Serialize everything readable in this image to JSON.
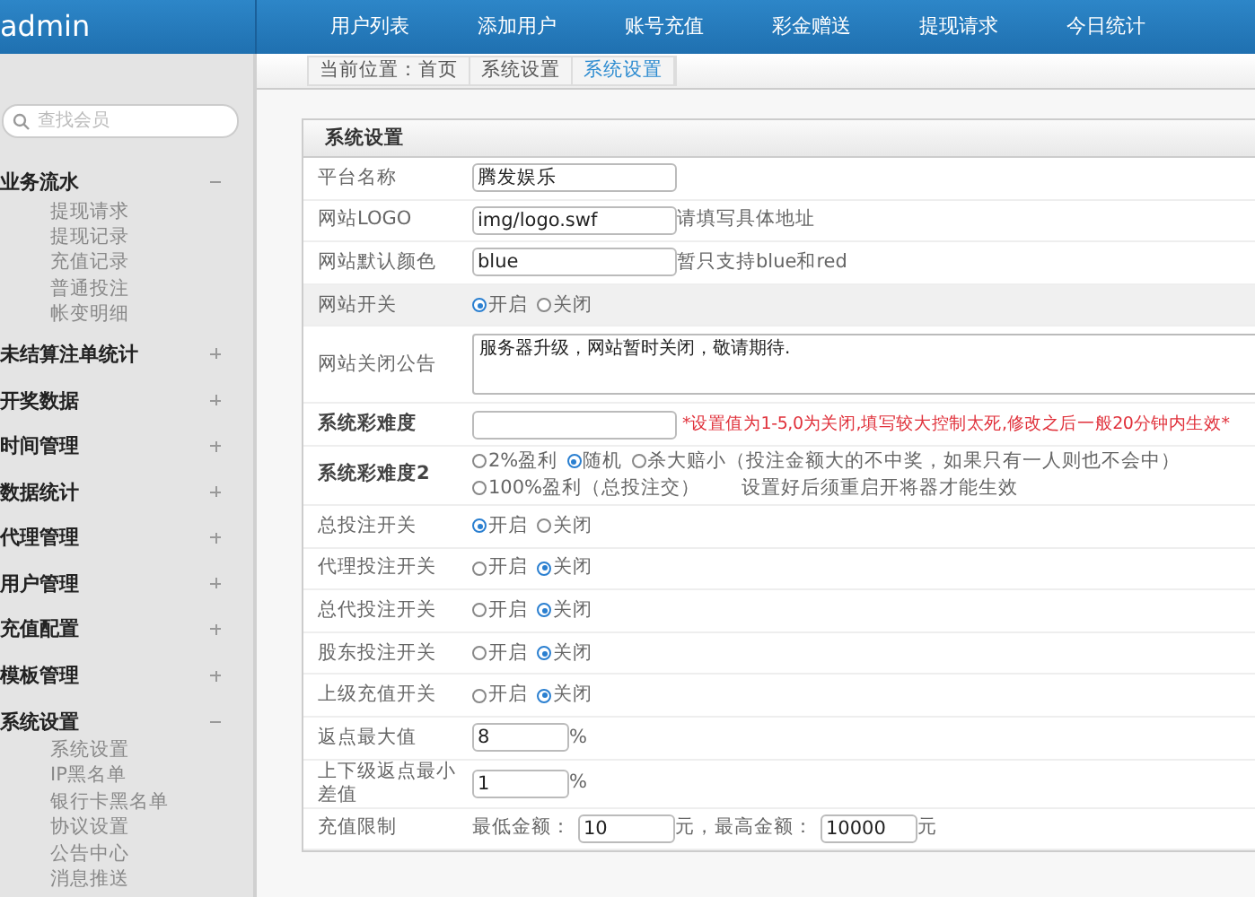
{
  "header": {
    "brand": "admin",
    "nav": [
      "用户列表",
      "添加用户",
      "账号充值",
      "彩金赠送",
      "提现请求",
      "今日统计"
    ]
  },
  "breadcrumb": [
    {
      "text": "当前位置：首页",
      "selected": false
    },
    {
      "text": "系统设置",
      "selected": false
    },
    {
      "text": "系统设置",
      "selected": true
    }
  ],
  "sidebar": {
    "search": {
      "placeholder": "查找会员"
    },
    "groups": [
      {
        "label": "业务流水",
        "expanded": true,
        "children": [
          "提现请求",
          "提现记录",
          "充值记录",
          "普通投注",
          "帐变明细"
        ]
      },
      {
        "label": "未结算注单统计",
        "expanded": false
      },
      {
        "label": "开奖数据",
        "expanded": false
      },
      {
        "label": "时间管理",
        "expanded": false
      },
      {
        "label": "数据统计",
        "expanded": false
      },
      {
        "label": "代理管理",
        "expanded": false
      },
      {
        "label": "用户管理",
        "expanded": false
      },
      {
        "label": "充值配置",
        "expanded": false
      },
      {
        "label": "模板管理",
        "expanded": false
      },
      {
        "label": "系统设置",
        "expanded": true,
        "children": [
          "系统设置",
          "IP黑名单",
          "银行卡黑名单",
          "协议设置",
          "公告中心",
          "消息推送"
        ]
      }
    ]
  },
  "panel": {
    "title": "系统设置",
    "rows": [
      {
        "label": "平台名称",
        "bold": false,
        "highlighted": false,
        "controls": [
          {
            "kind": "input",
            "value": "腾发娱乐"
          }
        ]
      },
      {
        "label": "网站LOGO",
        "bold": false,
        "highlighted": false,
        "controls": [
          {
            "kind": "input",
            "value": "img/logo.swf"
          },
          {
            "kind": "hint",
            "text": "请填写具体地址"
          }
        ]
      },
      {
        "label": "网站默认颜色",
        "bold": false,
        "highlighted": false,
        "controls": [
          {
            "kind": "input",
            "value": "blue"
          },
          {
            "kind": "hint",
            "text": "暂只支持blue和red"
          }
        ]
      },
      {
        "label": "网站开关",
        "bold": false,
        "highlighted": true,
        "controls": [
          {
            "kind": "radio",
            "text": "开启",
            "selected": true
          },
          {
            "kind": "radio",
            "text": "关闭",
            "selected": false
          }
        ]
      },
      {
        "label": "网站关闭公告",
        "bold": false,
        "highlighted": false,
        "controls": [
          {
            "kind": "textarea",
            "value": "服务器升级，网站暂时关闭，敬请期待."
          }
        ]
      },
      {
        "label": "系统彩难度",
        "bold": true,
        "highlighted": false,
        "controls": [
          {
            "kind": "input"
          },
          {
            "kind": "warning",
            "text": "*设置值为1-5,0为关闭,填写较大控制太死,修改之后一般20分钟内生效*"
          }
        ]
      },
      {
        "label": "系统彩难度2",
        "bold": true,
        "highlighted": false,
        "controls": [
          {
            "kind": "radio",
            "text": "2%盈利",
            "selected": false
          },
          {
            "kind": "radio",
            "text": "随机",
            "selected": true
          },
          {
            "kind": "radio",
            "text": "杀大赔小（投注金额大的不中奖，如果只有一人则也不会中）",
            "selected": false
          },
          {
            "kind": "radio",
            "text": "100%盈利（总投注交）",
            "selected": false
          },
          {
            "kind": "hint",
            "text": "设置好后须重启开将器才能生效"
          }
        ]
      },
      {
        "label": "总投注开关",
        "bold": false,
        "highlighted": false,
        "controls": [
          {
            "kind": "radio",
            "text": "开启",
            "selected": true
          },
          {
            "kind": "radio",
            "text": "关闭",
            "selected": false
          }
        ]
      },
      {
        "label": "代理投注开关",
        "bold": false,
        "highlighted": false,
        "controls": [
          {
            "kind": "radio",
            "text": "开启",
            "selected": false
          },
          {
            "kind": "radio",
            "text": "关闭",
            "selected": true
          }
        ]
      },
      {
        "label": "总代投注开关",
        "bold": false,
        "highlighted": false,
        "controls": [
          {
            "kind": "radio",
            "text": "开启",
            "selected": false
          },
          {
            "kind": "radio",
            "text": "关闭",
            "selected": true
          }
        ]
      },
      {
        "label": "股东投注开关",
        "bold": false,
        "highlighted": false,
        "controls": [
          {
            "kind": "radio",
            "text": "开启",
            "selected": false
          },
          {
            "kind": "radio",
            "text": "关闭",
            "selected": true
          }
        ]
      },
      {
        "label": "上级充值开关",
        "bold": false,
        "highlighted": false,
        "controls": [
          {
            "kind": "radio",
            "text": "开启",
            "selected": false
          },
          {
            "kind": "radio",
            "text": "关闭",
            "selected": true
          }
        ]
      },
      {
        "label": "返点最大值",
        "bold": false,
        "highlighted": false,
        "controls": [
          {
            "kind": "short-input",
            "value": "8"
          },
          {
            "kind": "hint",
            "text": "%"
          }
        ]
      },
      {
        "label": "上下级返点最小差值",
        "bold": false,
        "highlighted": false,
        "controls": [
          {
            "kind": "short-input",
            "value": "1"
          },
          {
            "kind": "hint",
            "text": "%"
          }
        ]
      },
      {
        "label": "充值限制",
        "bold": false,
        "highlighted": false,
        "controls": [
          {
            "kind": "hint",
            "text": "最低金额："
          },
          {
            "kind": "short-input",
            "value": "10"
          },
          {
            "kind": "hint",
            "text": "元，最高金额："
          },
          {
            "kind": "short-input",
            "value": "10000"
          },
          {
            "kind": "hint",
            "text": "元"
          }
        ]
      }
    ]
  }
}
